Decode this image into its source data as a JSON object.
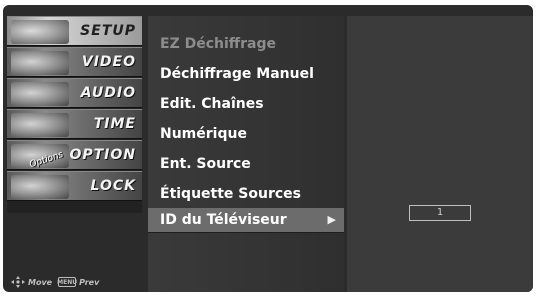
{
  "categories": [
    {
      "label": "SETUP",
      "selected": true
    },
    {
      "label": "VIDEO",
      "selected": false
    },
    {
      "label": "AUDIO",
      "selected": false
    },
    {
      "label": "TIME",
      "selected": false
    },
    {
      "label": "OPTION",
      "selected": false,
      "tag": "Options"
    },
    {
      "label": "LOCK",
      "selected": false
    }
  ],
  "hints": {
    "move_label": "Move",
    "prev_key": "MENU",
    "prev_label": "Prev"
  },
  "submenu": {
    "items": [
      {
        "label": "EZ Déchiffrage",
        "state": "dim"
      },
      {
        "label": "Déchiffrage Manuel",
        "state": "normal"
      },
      {
        "label": "Edit. Chaînes",
        "state": "normal"
      },
      {
        "label": "Numérique",
        "state": "normal"
      },
      {
        "label": "Ent. Source",
        "state": "normal"
      },
      {
        "label": "Étiquette Sources",
        "state": "normal"
      },
      {
        "label": "ID du Téléviseur",
        "state": "highlight",
        "arrow": "▶"
      }
    ]
  },
  "panel": {
    "tv_id_value": "1"
  }
}
